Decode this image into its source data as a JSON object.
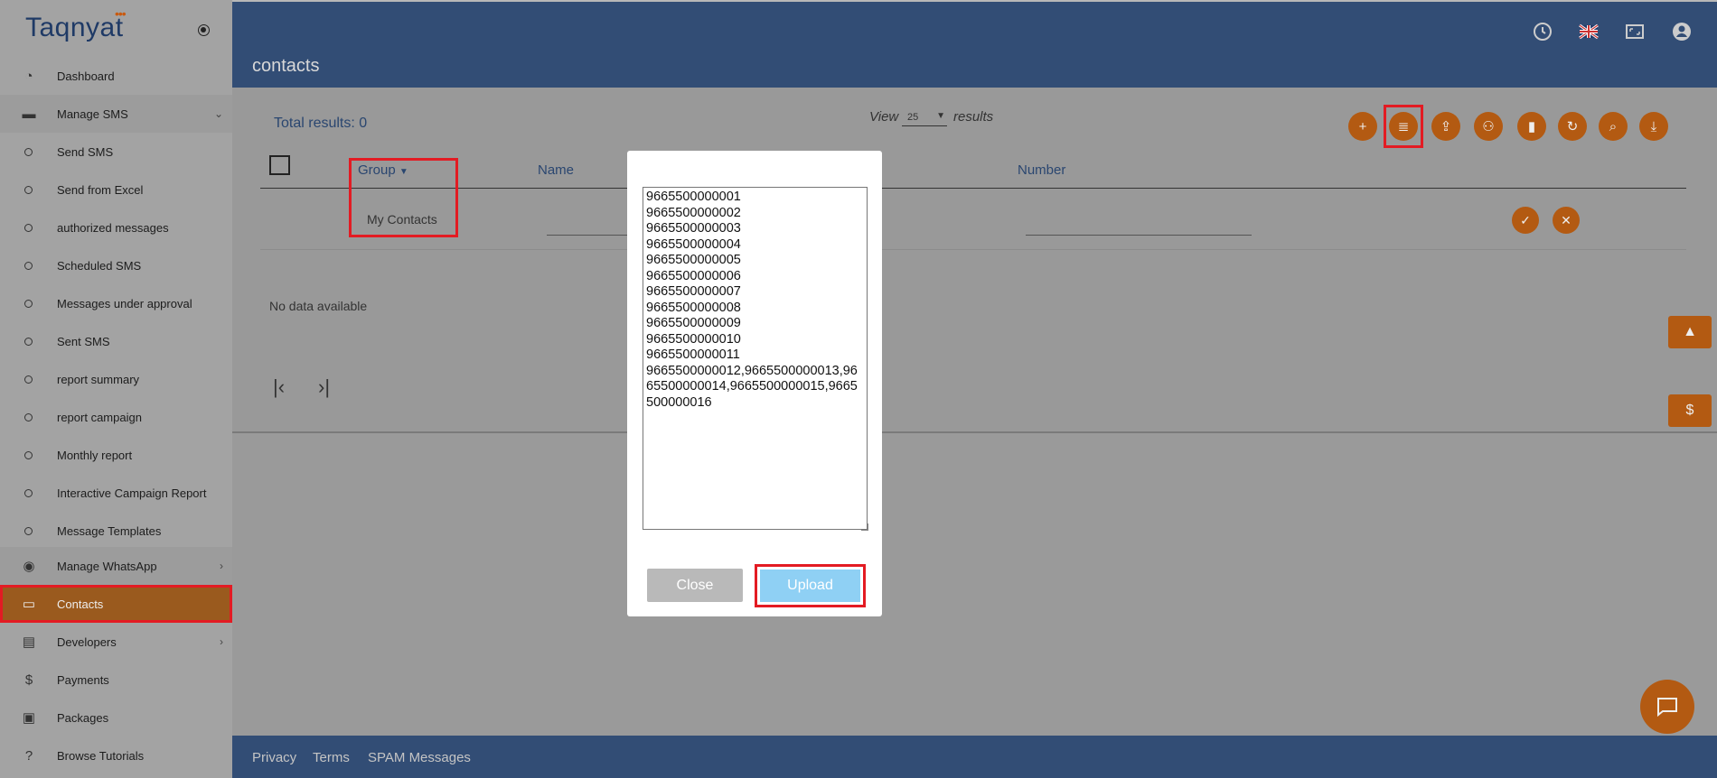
{
  "app": {
    "logo": "Taqnyat",
    "page_title": "contacts"
  },
  "sidebar": {
    "items": [
      {
        "label": "Dashboard",
        "icon": "dashboard-icon"
      },
      {
        "label": "Manage SMS",
        "icon": "sms-icon"
      },
      {
        "label": "Send SMS"
      },
      {
        "label": "Send from Excel"
      },
      {
        "label": "authorized messages"
      },
      {
        "label": "Scheduled SMS"
      },
      {
        "label": "Messages under approval"
      },
      {
        "label": "Sent SMS"
      },
      {
        "label": "report summary"
      },
      {
        "label": "report campaign"
      },
      {
        "label": "Monthly report"
      },
      {
        "label": "Interactive Campaign Report"
      },
      {
        "label": "Message Templates"
      },
      {
        "label": "Manage WhatsApp",
        "icon": "whatsapp-icon"
      },
      {
        "label": "Contacts",
        "icon": "contacts-book-icon"
      },
      {
        "label": "Developers",
        "icon": "developers-icon"
      },
      {
        "label": "Payments",
        "icon": "dollar-icon"
      },
      {
        "label": "Packages",
        "icon": "packages-icon"
      },
      {
        "label": "Browse Tutorials",
        "icon": "help-icon"
      }
    ]
  },
  "toolbar": {
    "total_results": "Total results: 0",
    "view_label": "View",
    "view_value": "25",
    "results_label": "results"
  },
  "table": {
    "columns": [
      "Group",
      "Name",
      "Number"
    ],
    "row_group": "My Contacts",
    "empty_text": "No data available"
  },
  "modal": {
    "numbers": "9665500000001\n9665500000002\n9665500000003\n9665500000004\n9665500000005\n9665500000006\n9665500000007\n9665500000008\n9665500000009\n9665500000010\n9665500000011\n9665500000012,9665500000013,9665500000014,9665500000015,9665500000016",
    "close_label": "Close",
    "upload_label": "Upload"
  },
  "footer": {
    "links": [
      "Privacy",
      "Terms",
      "SPAM Messages"
    ]
  },
  "colors": {
    "accent": "#b35a12",
    "header": "#324d75",
    "highlight": "#e31b23",
    "upload": "#8fd0f4"
  }
}
